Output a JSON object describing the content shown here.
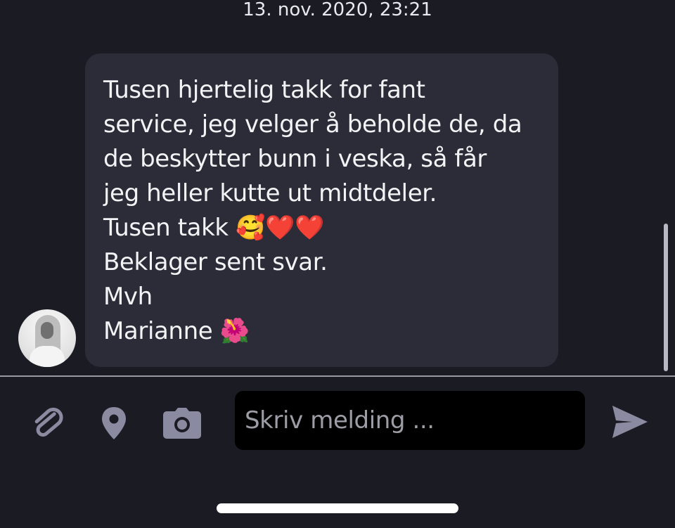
{
  "conversation": {
    "timestamp": "13. nov. 2020, 23:21"
  },
  "message": {
    "lines": [
      "Tusen hjertelig takk for fant",
      "service, jeg velger å beholde de, da",
      "de beskytter bunn i veska, så får",
      "jeg heller kutte ut midtdeler.",
      "Tusen takk 🥰❤️❤️",
      "Beklager sent svar.",
      "Mvh",
      "Marianne 🌺"
    ]
  },
  "composer": {
    "placeholder": "Skriv melding ...",
    "value": "",
    "icons": {
      "attach": "paperclip-icon",
      "location": "location-pin-icon",
      "camera": "camera-icon",
      "send": "send-icon"
    }
  },
  "colors": {
    "background": "#1b1b24",
    "bubble": "#2c2c38",
    "icon": "#8a8aa0",
    "input_background": "#000000",
    "text": "#f3f3f6"
  }
}
